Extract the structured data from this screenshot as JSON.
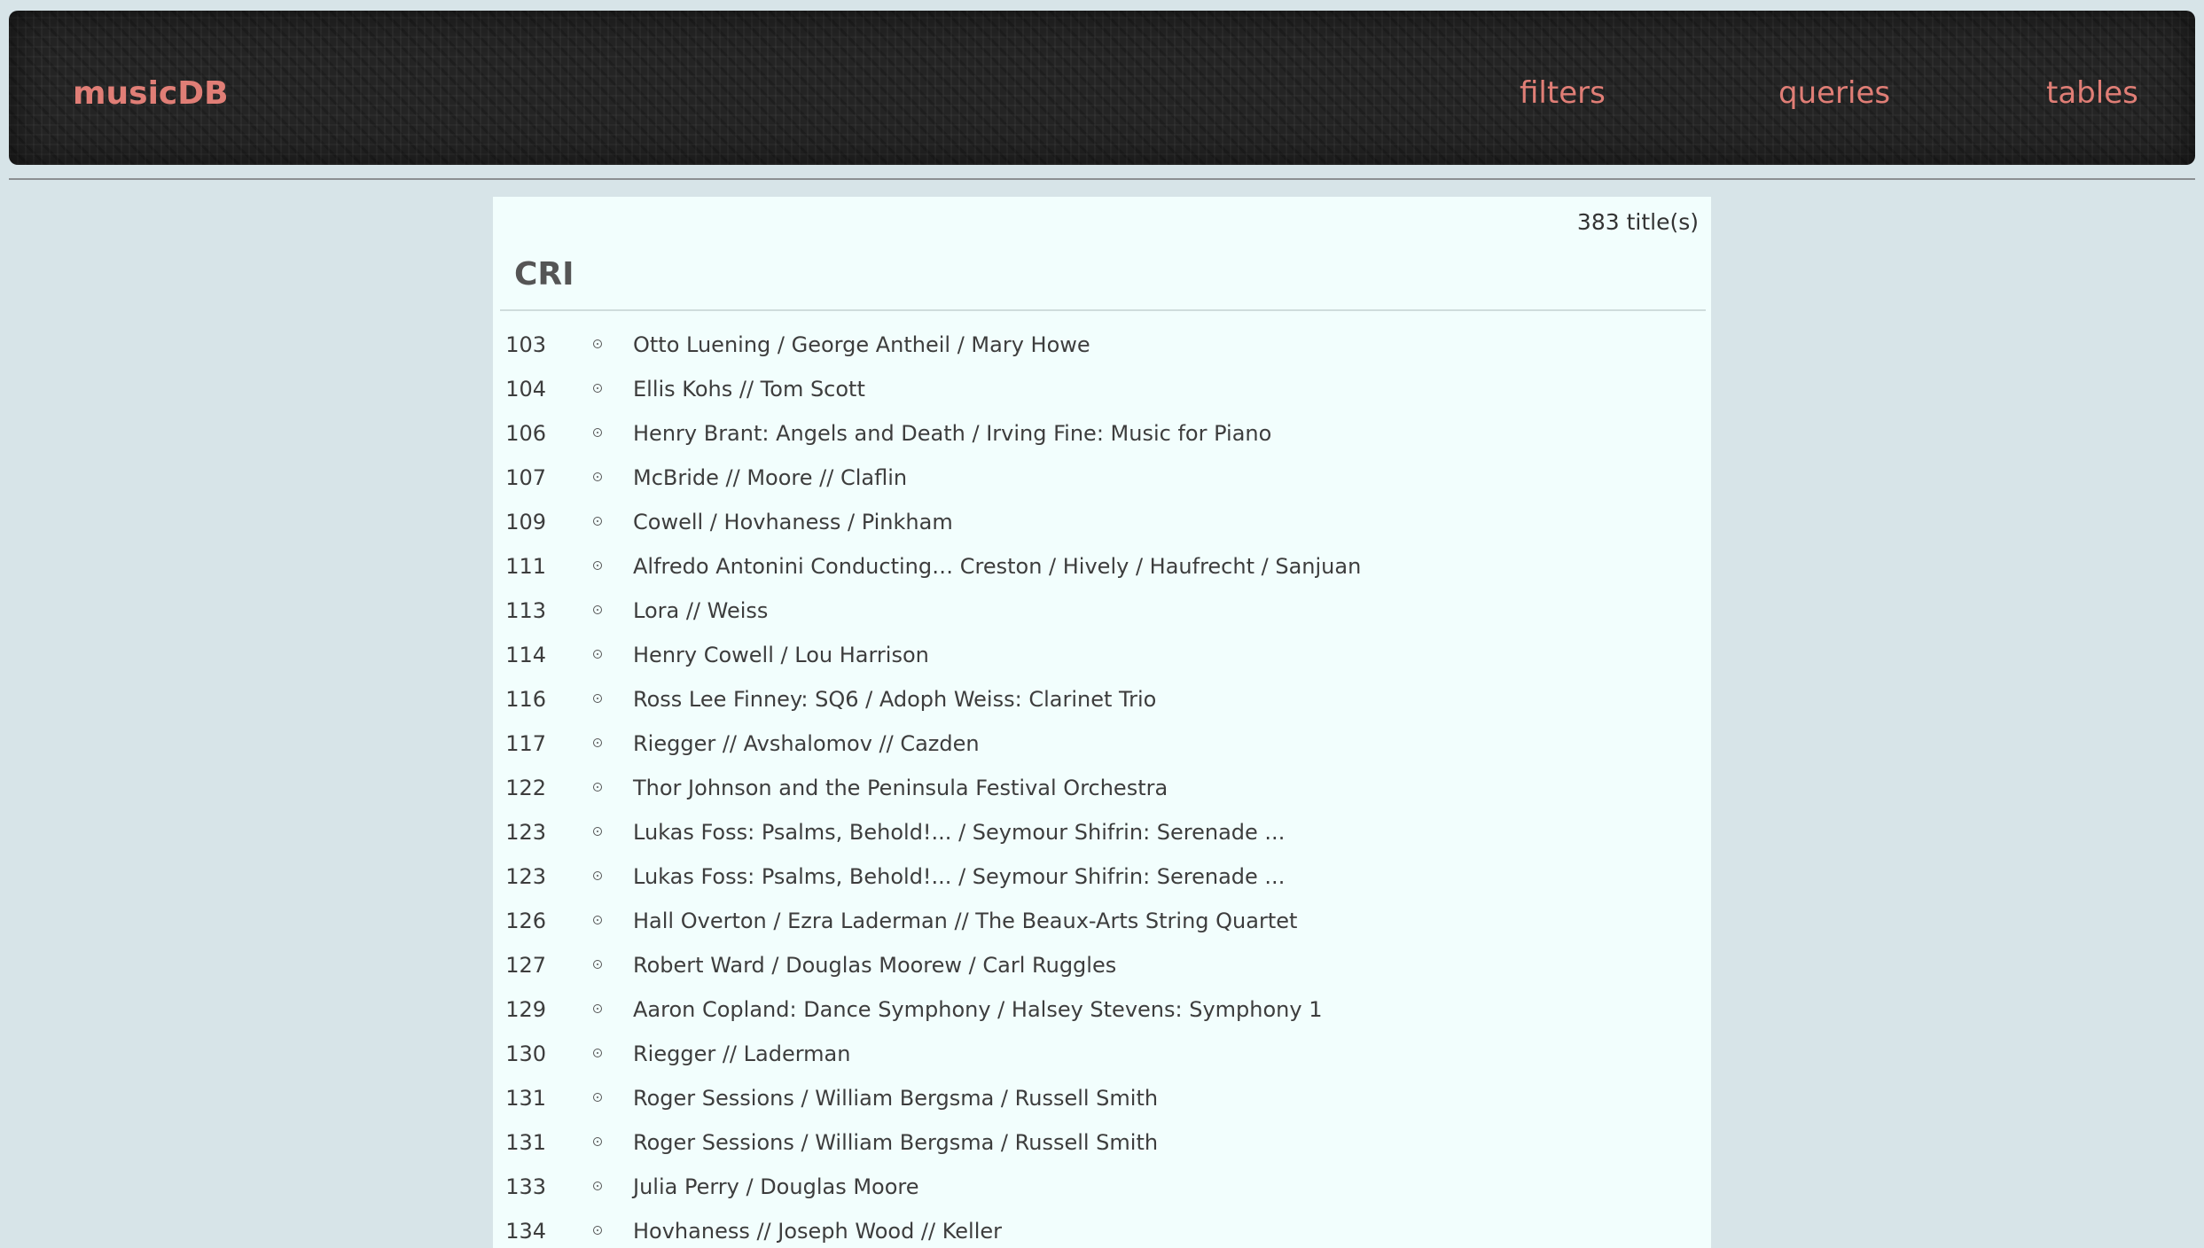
{
  "header": {
    "brand": "musicDB",
    "nav": {
      "filters": "filters",
      "queries": "queries",
      "tables": "tables"
    }
  },
  "main": {
    "count_label": "383 title(s)",
    "group_title": "CRI",
    "items": [
      {
        "num": "103",
        "title": "Otto Luening / George Antheil / Mary Howe"
      },
      {
        "num": "104",
        "title": "Ellis Kohs // Tom Scott"
      },
      {
        "num": "106",
        "title": "Henry Brant: Angels and Death / Irving Fine: Music for Piano"
      },
      {
        "num": "107",
        "title": "McBride // Moore // Claflin"
      },
      {
        "num": "109",
        "title": "Cowell / Hovhaness / Pinkham"
      },
      {
        "num": "111",
        "title": "Alfredo Antonini Conducting… Creston / Hively / Haufrecht / Sanjuan"
      },
      {
        "num": "113",
        "title": "Lora // Weiss"
      },
      {
        "num": "114",
        "title": "Henry Cowell / Lou Harrison"
      },
      {
        "num": "116",
        "title": "Ross Lee Finney: SQ6 / Adoph Weiss: Clarinet Trio"
      },
      {
        "num": "117",
        "title": "Riegger // Avshalomov // Cazden"
      },
      {
        "num": "122",
        "title": "Thor Johnson and the Peninsula Festival Orchestra"
      },
      {
        "num": "123",
        "title": "Lukas Foss: Psalms, Behold!... / Seymour Shifrin: Serenade ..."
      },
      {
        "num": "123",
        "title": "Lukas Foss: Psalms, Behold!... / Seymour Shifrin: Serenade ..."
      },
      {
        "num": "126",
        "title": "Hall Overton / Ezra Laderman // The Beaux-Arts String Quartet"
      },
      {
        "num": "127",
        "title": "Robert Ward / Douglas Moorew / Carl Ruggles"
      },
      {
        "num": "129",
        "title": "Aaron Copland: Dance Symphony / Halsey Stevens: Symphony 1"
      },
      {
        "num": "130",
        "title": "Riegger // Laderman"
      },
      {
        "num": "131",
        "title": "Roger Sessions / William Bergsma / Russell Smith"
      },
      {
        "num": "131",
        "title": "Roger Sessions / William Bergsma / Russell Smith"
      },
      {
        "num": "133",
        "title": "Julia Perry / Douglas Moore"
      },
      {
        "num": "134",
        "title": "Hovhaness // Joseph Wood // Keller"
      }
    ]
  }
}
